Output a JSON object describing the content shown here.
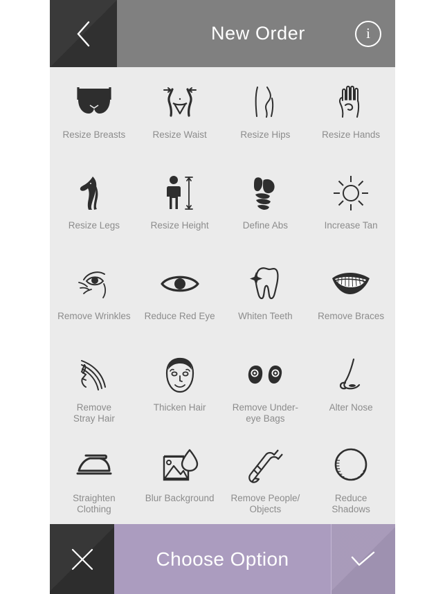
{
  "header": {
    "title": "New Order",
    "back_icon": "chevron-left-icon",
    "info_icon": "info-icon",
    "info_glyph": "i",
    "bg_color": "#808080",
    "back_bg_color": "#333333"
  },
  "grid": {
    "bg_color": "#ebebeb",
    "label_color": "#8c8c8c",
    "columns": 4,
    "rows": 5,
    "items": [
      {
        "label": "Resize Breasts",
        "icon": "bra-icon"
      },
      {
        "label": "Resize Waist",
        "icon": "waist-icon"
      },
      {
        "label": "Resize Hips",
        "icon": "hips-icon"
      },
      {
        "label": "Resize Hands",
        "icon": "hand-icon"
      },
      {
        "label": "Resize Legs",
        "icon": "legs-icon"
      },
      {
        "label": "Resize Height",
        "icon": "height-ruler-icon"
      },
      {
        "label": "Define Abs",
        "icon": "abs-icon"
      },
      {
        "label": "Increase Tan",
        "icon": "sun-icon"
      },
      {
        "label": "Remove Wrinkles",
        "icon": "wrinkle-eye-icon"
      },
      {
        "label": "Reduce Red Eye",
        "icon": "eye-icon"
      },
      {
        "label": "Whiten Teeth",
        "icon": "tooth-sparkle-icon"
      },
      {
        "label": "Remove Braces",
        "icon": "braces-mouth-icon"
      },
      {
        "label": "Remove\nStray Hair",
        "icon": "flowing-hair-icon"
      },
      {
        "label": "Thicken Hair",
        "icon": "balding-head-icon"
      },
      {
        "label": "Remove Under-\neye Bags",
        "icon": "under-eye-bags-icon"
      },
      {
        "label": "Alter Nose",
        "icon": "nose-icon"
      },
      {
        "label": "Straighten\nClothing",
        "icon": "iron-icon"
      },
      {
        "label": "Blur Background",
        "icon": "photo-droplet-icon"
      },
      {
        "label": "Remove People/\nObjects",
        "icon": "eraser-icon"
      },
      {
        "label": "Reduce\nShadows",
        "icon": "shadow-circle-icon"
      }
    ]
  },
  "footer": {
    "cancel_icon": "close-x-icon",
    "choose_label": "Choose Option",
    "confirm_icon": "checkmark-icon",
    "choose_bg_color": "#ab9cbf",
    "confirm_bg_color": "#a496b6",
    "cancel_bg_color": "#2f2f2f"
  }
}
